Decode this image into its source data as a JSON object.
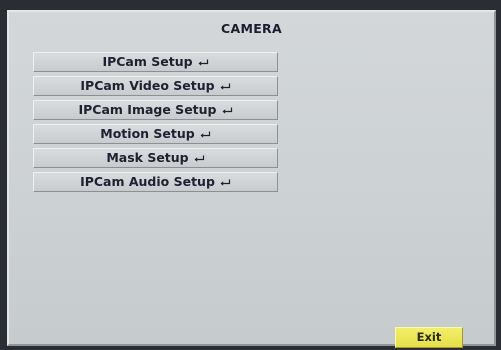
{
  "screen": {
    "title": "CAMERA"
  },
  "menu": {
    "items": [
      {
        "label": "IPCam Setup",
        "icon": "enter-icon"
      },
      {
        "label": "IPCam Video Setup",
        "icon": "enter-icon"
      },
      {
        "label": "IPCam Image Setup",
        "icon": "enter-icon"
      },
      {
        "label": "Motion Setup",
        "icon": "enter-icon"
      },
      {
        "label": "Mask Setup",
        "icon": "enter-icon"
      },
      {
        "label": "IPCam Audio Setup",
        "icon": "enter-icon"
      }
    ]
  },
  "footer": {
    "exit_label": "Exit"
  },
  "colors": {
    "panel": "#cdd2d4",
    "exit_button": "#e9e352",
    "text": "#1e2130"
  }
}
